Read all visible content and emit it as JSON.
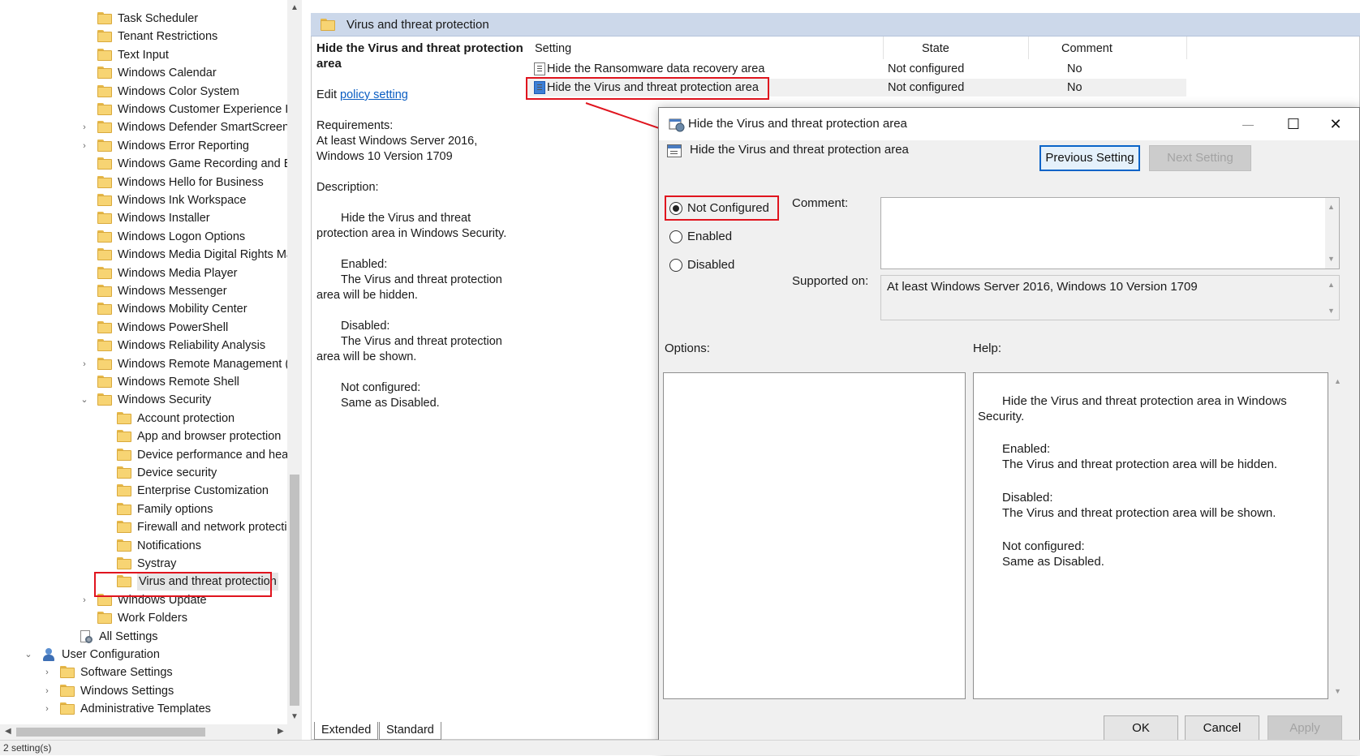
{
  "tree": {
    "items": [
      {
        "label": "Task Scheduler",
        "indent": 2,
        "expander": "",
        "icon": "folder"
      },
      {
        "label": "Tenant Restrictions",
        "indent": 2,
        "expander": "",
        "icon": "folder"
      },
      {
        "label": "Text Input",
        "indent": 2,
        "expander": "",
        "icon": "folder"
      },
      {
        "label": "Windows Calendar",
        "indent": 2,
        "expander": "",
        "icon": "folder"
      },
      {
        "label": "Windows Color System",
        "indent": 2,
        "expander": "",
        "icon": "folder"
      },
      {
        "label": "Windows Customer Experience Imp",
        "indent": 2,
        "expander": "",
        "icon": "folder"
      },
      {
        "label": "Windows Defender SmartScreen",
        "indent": 2,
        "expander": "›",
        "icon": "folder"
      },
      {
        "label": "Windows Error Reporting",
        "indent": 2,
        "expander": "›",
        "icon": "folder"
      },
      {
        "label": "Windows Game Recording and Bro",
        "indent": 2,
        "expander": "",
        "icon": "folder"
      },
      {
        "label": "Windows Hello for Business",
        "indent": 2,
        "expander": "",
        "icon": "folder"
      },
      {
        "label": "Windows Ink Workspace",
        "indent": 2,
        "expander": "",
        "icon": "folder"
      },
      {
        "label": "Windows Installer",
        "indent": 2,
        "expander": "",
        "icon": "folder"
      },
      {
        "label": "Windows Logon Options",
        "indent": 2,
        "expander": "",
        "icon": "folder"
      },
      {
        "label": "Windows Media Digital Rights Mar",
        "indent": 2,
        "expander": "",
        "icon": "folder"
      },
      {
        "label": "Windows Media Player",
        "indent": 2,
        "expander": "",
        "icon": "folder"
      },
      {
        "label": "Windows Messenger",
        "indent": 2,
        "expander": "",
        "icon": "folder"
      },
      {
        "label": "Windows Mobility Center",
        "indent": 2,
        "expander": "",
        "icon": "folder"
      },
      {
        "label": "Windows PowerShell",
        "indent": 2,
        "expander": "",
        "icon": "folder"
      },
      {
        "label": "Windows Reliability Analysis",
        "indent": 2,
        "expander": "",
        "icon": "folder"
      },
      {
        "label": "Windows Remote Management (W",
        "indent": 2,
        "expander": "›",
        "icon": "folder"
      },
      {
        "label": "Windows Remote Shell",
        "indent": 2,
        "expander": "",
        "icon": "folder"
      },
      {
        "label": "Windows Security",
        "indent": 2,
        "expander": "⌄",
        "icon": "folder"
      },
      {
        "label": "Account protection",
        "indent": 3,
        "expander": "",
        "icon": "folder"
      },
      {
        "label": "App and browser protection",
        "indent": 3,
        "expander": "",
        "icon": "folder"
      },
      {
        "label": "Device performance and health",
        "indent": 3,
        "expander": "",
        "icon": "folder"
      },
      {
        "label": "Device security",
        "indent": 3,
        "expander": "",
        "icon": "folder"
      },
      {
        "label": "Enterprise Customization",
        "indent": 3,
        "expander": "",
        "icon": "folder"
      },
      {
        "label": "Family options",
        "indent": 3,
        "expander": "",
        "icon": "folder"
      },
      {
        "label": "Firewall and network protection",
        "indent": 3,
        "expander": "",
        "icon": "folder"
      },
      {
        "label": "Notifications",
        "indent": 3,
        "expander": "",
        "icon": "folder"
      },
      {
        "label": "Systray",
        "indent": 3,
        "expander": "",
        "icon": "folder"
      },
      {
        "label": "Virus and threat protection",
        "indent": 3,
        "expander": "",
        "icon": "folder",
        "selected": true
      },
      {
        "label": "Windows Update",
        "indent": 2,
        "expander": "›",
        "icon": "folder"
      },
      {
        "label": "Work Folders",
        "indent": 2,
        "expander": "",
        "icon": "folder"
      },
      {
        "label": "All Settings",
        "indent": 1.5,
        "expander": "",
        "icon": "settings"
      },
      {
        "label": "User Configuration",
        "indent": 0.5,
        "expander": "⌄",
        "icon": "user"
      },
      {
        "label": "Software Settings",
        "indent": 1,
        "expander": "›",
        "icon": "folder"
      },
      {
        "label": "Windows Settings",
        "indent": 1,
        "expander": "›",
        "icon": "folder"
      },
      {
        "label": "Administrative Templates",
        "indent": 1,
        "expander": "›",
        "icon": "folder"
      }
    ]
  },
  "status_bar": "2 setting(s)",
  "pane": {
    "header_title": "Virus and threat protection",
    "extended": {
      "title_line1": "Hide the Virus and threat protection",
      "title_line2": "area",
      "edit_prefix": "Edit",
      "edit_link": "policy setting",
      "requirements_label": "Requirements:",
      "requirements_line1": "At least Windows Server 2016,",
      "requirements_line2": "Windows 10 Version 1709",
      "description_label": "Description:",
      "desc_line1": "Hide the Virus and threat",
      "desc_line2": "protection area in Windows Security.",
      "enabled_label": "Enabled:",
      "enabled_line1": "The Virus and threat protection",
      "enabled_line2": "area will be hidden.",
      "disabled_label": "Disabled:",
      "disabled_line1": "The Virus and threat protection",
      "disabled_line2": "area will be shown.",
      "notconf_label": "Not configured:",
      "notconf_line1": "Same as Disabled."
    },
    "columns": [
      "Setting",
      "State",
      "Comment"
    ],
    "rows": [
      {
        "setting": "Hide the Ransomware data recovery area",
        "state": "Not configured",
        "comment": "No"
      },
      {
        "setting": "Hide the Virus and threat protection area",
        "state": "Not configured",
        "comment": "No"
      }
    ],
    "tabs": [
      "Extended",
      "Standard"
    ]
  },
  "dialog": {
    "title": "Hide the Virus and threat protection area",
    "window_controls": {
      "minimize": "—",
      "maximize": "☐",
      "close": "✕"
    },
    "policy_name": "Hide the Virus and threat protection area",
    "previous_button": "Previous Setting",
    "next_button": "Next Setting",
    "radios": [
      {
        "label": "Not Configured",
        "checked": true
      },
      {
        "label": "Enabled",
        "checked": false
      },
      {
        "label": "Disabled",
        "checked": false
      }
    ],
    "comment_label": "Comment:",
    "comment_value": "",
    "supported_label": "Supported on:",
    "supported_value": "At least Windows Server 2016, Windows 10 Version 1709",
    "options_label": "Options:",
    "help_label": "Help:",
    "help": {
      "line1": "Hide the Virus and threat protection area in Windows",
      "line2": "Security.",
      "enabled_label": "Enabled:",
      "enabled_text": "The Virus and threat protection area will be hidden.",
      "disabled_label": "Disabled:",
      "disabled_text": "The Virus and threat protection area will be shown.",
      "notconf_label": "Not configured:",
      "notconf_text": "Same as Disabled."
    },
    "ok_button": "OK",
    "cancel_button": "Cancel",
    "apply_button": "Apply"
  },
  "colors": {
    "annotation_red": "#e0141e",
    "header_blue": "#ccd8ea",
    "link_blue": "#0a5dc2",
    "focus_blue": "#0a64c8"
  }
}
